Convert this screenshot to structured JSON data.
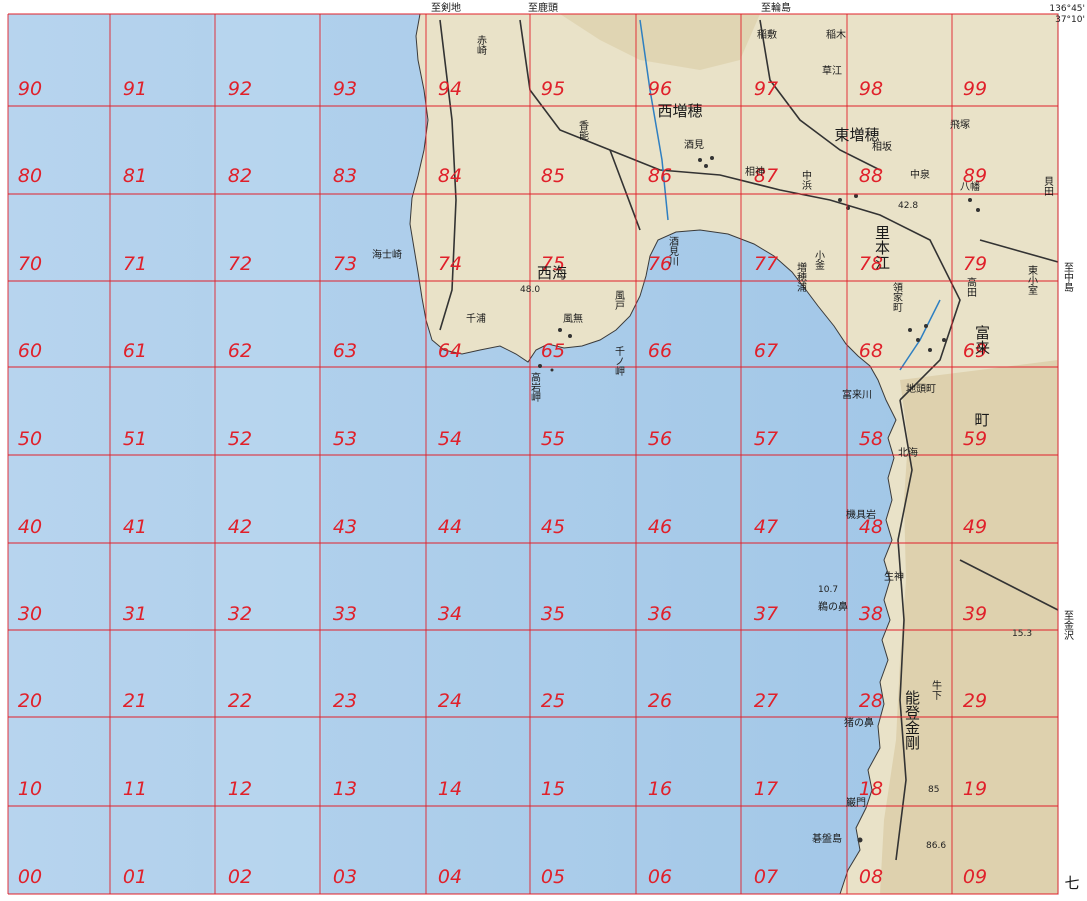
{
  "map": {
    "colors": {
      "sea": "#a9cbe9",
      "sea_light": "#cfe2f3",
      "land": "#e9e2c8",
      "land_dark": "#d8cba2",
      "grid": "#e0202a",
      "label": "#e0202a",
      "road": "#333333"
    },
    "grid_labels": [
      "90",
      "91",
      "92",
      "93",
      "94",
      "95",
      "96",
      "97",
      "98",
      "99",
      "80",
      "81",
      "82",
      "83",
      "84",
      "85",
      "86",
      "87",
      "88",
      "89",
      "70",
      "71",
      "72",
      "73",
      "74",
      "75",
      "76",
      "77",
      "78",
      "79",
      "60",
      "61",
      "62",
      "63",
      "64",
      "65",
      "66",
      "67",
      "68",
      "69",
      "50",
      "51",
      "52",
      "53",
      "54",
      "55",
      "56",
      "57",
      "58",
      "59",
      "40",
      "41",
      "42",
      "43",
      "44",
      "45",
      "46",
      "47",
      "48",
      "49",
      "30",
      "31",
      "32",
      "33",
      "34",
      "35",
      "36",
      "37",
      "38",
      "39",
      "20",
      "21",
      "22",
      "23",
      "24",
      "25",
      "26",
      "27",
      "28",
      "29",
      "10",
      "11",
      "12",
      "13",
      "14",
      "15",
      "16",
      "17",
      "18",
      "19",
      "00",
      "01",
      "02",
      "03",
      "04",
      "05",
      "06",
      "07",
      "08",
      "09"
    ],
    "top_labels": [
      "至剣地",
      "至鹿頭",
      "至輪島"
    ],
    "corner_coords": [
      "136°45'",
      "37°10'"
    ],
    "right_labels": [
      "至中島",
      "至金沢"
    ],
    "corner_mark": "七",
    "places_large": [
      "西増穂",
      "東増穂",
      "西海",
      "富来",
      "町",
      "里本江",
      "能登金剛"
    ],
    "places": [
      {
        "name": "赤崎"
      },
      {
        "name": "香能"
      },
      {
        "name": "酒見"
      },
      {
        "name": "相神"
      },
      {
        "name": "中浜"
      },
      {
        "name": "稲敷"
      },
      {
        "name": "稲木"
      },
      {
        "name": "草江"
      },
      {
        "name": "相坂"
      },
      {
        "name": "中泉"
      },
      {
        "name": "飛塚"
      },
      {
        "name": "八幡"
      },
      {
        "name": "貝田"
      },
      {
        "name": "東小室"
      },
      {
        "name": "高田"
      },
      {
        "name": "領家町"
      },
      {
        "name": "地頭町"
      },
      {
        "name": "富来川"
      },
      {
        "name": "北海"
      },
      {
        "name": "生神"
      },
      {
        "name": "牛下"
      },
      {
        "name": "千浦"
      },
      {
        "name": "風無"
      },
      {
        "name": "風戸"
      },
      {
        "name": "海士崎"
      },
      {
        "name": "高岩岬"
      },
      {
        "name": "千ノ岬"
      },
      {
        "name": "酒見川"
      },
      {
        "name": "増穂浦"
      },
      {
        "name": "小釜"
      },
      {
        "name": "機具岩"
      },
      {
        "name": "鵜の鼻"
      },
      {
        "name": "猪の鼻"
      },
      {
        "name": "巌門"
      },
      {
        "name": "碁盤島"
      }
    ],
    "elevations": [
      "48.0",
      "42.8",
      "15.3",
      "10.7",
      "85",
      "86.6"
    ]
  }
}
